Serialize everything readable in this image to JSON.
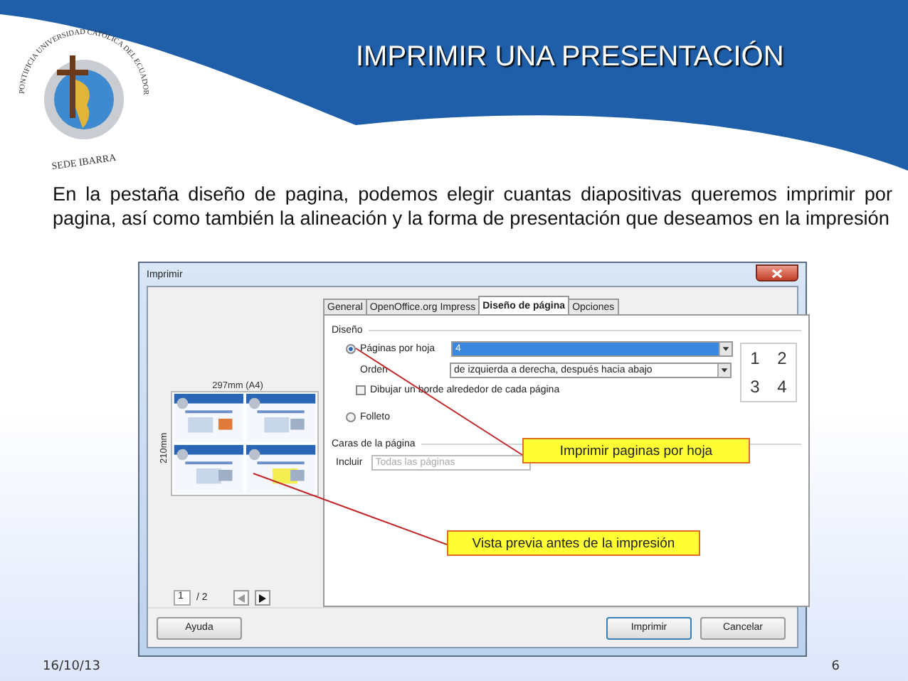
{
  "slide": {
    "title": "IMPRIMIR UNA PRESENTACIÓN",
    "logo": {
      "arc_text": "PONTIFICIA UNIVERSIDAD CATÓLICA DEL ECUADOR",
      "caption": "SEDE IBARRA"
    },
    "paragraph": "En la pestaña diseño de pagina, podemos elegir cuantas diapositivas queremos imprimir por pagina, así como también la alineación y la forma de presentación que deseamos en la impresión",
    "date": "16/10/13",
    "page_number": "6"
  },
  "dialog": {
    "title": "Imprimir",
    "preview": {
      "width_label": "297mm (A4)",
      "height_label": "210mm",
      "page_field": "1",
      "page_total": "/ 2"
    },
    "tabs": [
      {
        "label": "General",
        "selected": false
      },
      {
        "label": "OpenOffice.org Impress",
        "selected": false
      },
      {
        "label": "Diseño de página",
        "selected": true
      },
      {
        "label": "Opciones",
        "selected": false
      }
    ],
    "layout_section": "Diseño",
    "pages_per_sheet": {
      "label": "Páginas por hoja",
      "selected": true,
      "value": "4"
    },
    "order": {
      "label": "Orden",
      "value": "de izquierda a derecha, después hacia abajo"
    },
    "border": {
      "label": "Dibujar un borde alrededor de cada página",
      "checked": false
    },
    "brochure": {
      "label": "Folleto",
      "selected": false
    },
    "order_preview": [
      "1",
      "2",
      "3",
      "4"
    ],
    "sides_section": "Caras de la página",
    "include": {
      "label": "Incluir",
      "placeholder": "Todas las páginas"
    },
    "buttons": [
      {
        "label": "Ayuda",
        "kind": "help"
      },
      {
        "label": "Imprimir",
        "kind": "default"
      },
      {
        "label": "Cancelar",
        "kind": "normal"
      }
    ]
  },
  "annotations": [
    {
      "text": "Imprimir paginas por hoja"
    },
    {
      "text": "Vista previa antes de la impresión"
    }
  ]
}
